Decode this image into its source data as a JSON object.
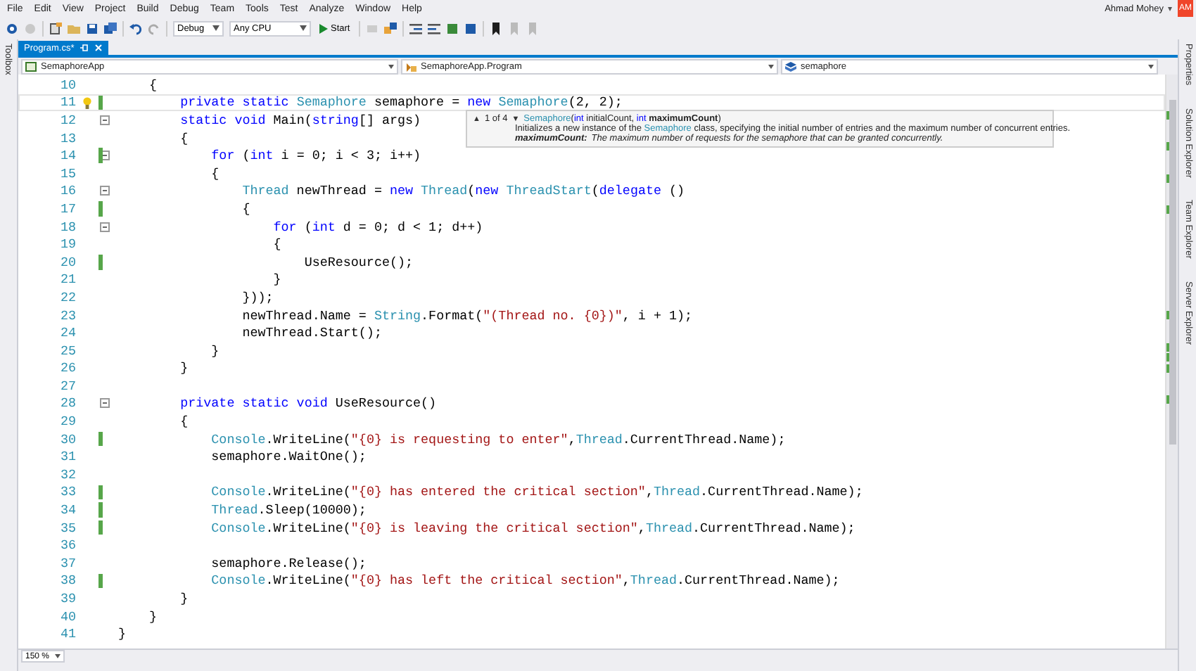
{
  "menu": [
    "File",
    "Edit",
    "View",
    "Project",
    "Build",
    "Debug",
    "Team",
    "Tools",
    "Test",
    "Analyze",
    "Window",
    "Help"
  ],
  "user": {
    "name": "Ahmad Mohey",
    "caret": "▾",
    "initials": "AM"
  },
  "toolbar": {
    "configuration": "Debug",
    "platform": "Any CPU",
    "start": "Start"
  },
  "toolbox": {
    "label": "Toolbox"
  },
  "tabs": [
    {
      "label": "Program.cs*",
      "selected": true
    }
  ],
  "nav": [
    "SemaphoreApp",
    "SemaphoreApp.Program",
    "semaphore"
  ],
  "editor": {
    "lines": [
      {
        "n": "10",
        "changed": false,
        "current": false,
        "tokens": [
          {
            "text": "    {",
            "kind": "plain"
          }
        ]
      },
      {
        "n": "11",
        "changed": true,
        "current": true,
        "lightbulb": true,
        "tokens": [
          {
            "text": "        private static ",
            "kind": "kw"
          },
          {
            "text": "Semaphore",
            "kind": "type"
          },
          {
            "text": " semaphore = ",
            "kind": "plain"
          },
          {
            "text": "new ",
            "kind": "kw"
          },
          {
            "text": "Semaphore",
            "kind": "type"
          },
          {
            "text": "(2, 2);",
            "kind": "plain"
          }
        ]
      },
      {
        "n": "12",
        "changed": false,
        "current": false,
        "expanded": true,
        "tokens": [
          {
            "text": "        static void ",
            "kind": "kw"
          },
          {
            "text": "Main(",
            "kind": "plain"
          },
          {
            "text": "string",
            "kind": "kw"
          },
          {
            "text": "[] args)",
            "kind": "plain"
          }
        ]
      },
      {
        "n": "13",
        "changed": false,
        "current": false,
        "tokens": [
          {
            "text": "        {",
            "kind": "plain"
          }
        ]
      },
      {
        "n": "14",
        "changed": true,
        "current": false,
        "expanded": true,
        "tokens": [
          {
            "text": "            for ",
            "kind": "kw"
          },
          {
            "text": "(",
            "kind": "plain"
          },
          {
            "text": "int",
            "kind": "kw"
          },
          {
            "text": " i = 0; i < 3; i++)",
            "kind": "plain"
          }
        ]
      },
      {
        "n": "15",
        "changed": false,
        "current": false,
        "tokens": [
          {
            "text": "            {",
            "kind": "plain"
          }
        ]
      },
      {
        "n": "16",
        "changed": false,
        "current": false,
        "expanded": true,
        "tokens": [
          {
            "text": "                Thread",
            "kind": "type"
          },
          {
            "text": " newThread = ",
            "kind": "plain"
          },
          {
            "text": "new ",
            "kind": "kw"
          },
          {
            "text": "Thread",
            "kind": "type"
          },
          {
            "text": "(",
            "kind": "plain"
          },
          {
            "text": "new ",
            "kind": "kw"
          },
          {
            "text": "ThreadStart",
            "kind": "type"
          },
          {
            "text": "(",
            "kind": "plain"
          },
          {
            "text": "delegate",
            "kind": "kw"
          },
          {
            "text": " ()",
            "kind": "plain"
          }
        ]
      },
      {
        "n": "17",
        "changed": true,
        "current": false,
        "tokens": [
          {
            "text": "                {",
            "kind": "plain"
          }
        ]
      },
      {
        "n": "18",
        "changed": false,
        "current": false,
        "expanded": true,
        "tokens": [
          {
            "text": "                    for ",
            "kind": "kw"
          },
          {
            "text": "(",
            "kind": "plain"
          },
          {
            "text": "int",
            "kind": "kw"
          },
          {
            "text": " d = 0; d < 1; d++)",
            "kind": "plain"
          }
        ]
      },
      {
        "n": "19",
        "changed": false,
        "current": false,
        "tokens": [
          {
            "text": "                    {",
            "kind": "plain"
          }
        ]
      },
      {
        "n": "20",
        "changed": true,
        "current": false,
        "tokens": [
          {
            "text": "                        UseResource();",
            "kind": "plain"
          }
        ]
      },
      {
        "n": "21",
        "changed": false,
        "current": false,
        "tokens": [
          {
            "text": "                    }",
            "kind": "plain"
          }
        ]
      },
      {
        "n": "22",
        "changed": false,
        "current": false,
        "tokens": [
          {
            "text": "                }));",
            "kind": "plain"
          }
        ]
      },
      {
        "n": "23",
        "changed": false,
        "current": false,
        "tokens": [
          {
            "text": "                newThread.Name = ",
            "kind": "plain"
          },
          {
            "text": "String",
            "kind": "type"
          },
          {
            "text": ".Format(",
            "kind": "plain"
          },
          {
            "text": "\"(Thread no. {0})\"",
            "kind": "str"
          },
          {
            "text": ", i + 1);",
            "kind": "plain"
          }
        ]
      },
      {
        "n": "24",
        "changed": false,
        "current": false,
        "tokens": [
          {
            "text": "                newThread.Start();",
            "kind": "plain"
          }
        ]
      },
      {
        "n": "25",
        "changed": false,
        "current": false,
        "tokens": [
          {
            "text": "            }",
            "kind": "plain"
          }
        ]
      },
      {
        "n": "26",
        "changed": false,
        "current": false,
        "tokens": [
          {
            "text": "        }",
            "kind": "plain"
          }
        ]
      },
      {
        "n": "27",
        "changed": false,
        "current": false
      },
      {
        "n": "28",
        "changed": false,
        "current": false,
        "expanded": true,
        "tokens": [
          {
            "text": "        private static void ",
            "kind": "kw"
          },
          {
            "text": "UseResource()",
            "kind": "plain"
          }
        ]
      },
      {
        "n": "29",
        "changed": false,
        "current": false,
        "tokens": [
          {
            "text": "        {",
            "kind": "plain"
          }
        ]
      },
      {
        "n": "30",
        "changed": true,
        "current": false,
        "tokens": [
          {
            "text": "            Console",
            "kind": "type"
          },
          {
            "text": ".WriteLine(",
            "kind": "plain"
          },
          {
            "text": "\"{0} is requesting to enter\"",
            "kind": "str"
          },
          {
            "text": ",",
            "kind": "plain"
          },
          {
            "text": "Thread",
            "kind": "type"
          },
          {
            "text": ".CurrentThread.Name);",
            "kind": "plain"
          }
        ]
      },
      {
        "n": "31",
        "changed": false,
        "current": false,
        "tokens": [
          {
            "text": "            semaphore.WaitOne();",
            "kind": "plain"
          }
        ]
      },
      {
        "n": "32",
        "changed": false,
        "current": false
      },
      {
        "n": "33",
        "changed": true,
        "current": false,
        "tokens": [
          {
            "text": "            Console",
            "kind": "type"
          },
          {
            "text": ".WriteLine(",
            "kind": "plain"
          },
          {
            "text": "\"{0} has entered the critical section\"",
            "kind": "str"
          },
          {
            "text": ",",
            "kind": "plain"
          },
          {
            "text": "Thread",
            "kind": "type"
          },
          {
            "text": ".CurrentThread.Name);",
            "kind": "plain"
          }
        ]
      },
      {
        "n": "34",
        "changed": true,
        "current": false,
        "tokens": [
          {
            "text": "            Thread",
            "kind": "type"
          },
          {
            "text": ".Sleep(10000);",
            "kind": "plain"
          }
        ]
      },
      {
        "n": "35",
        "changed": true,
        "current": false,
        "tokens": [
          {
            "text": "            Console",
            "kind": "type"
          },
          {
            "text": ".WriteLine(",
            "kind": "plain"
          },
          {
            "text": "\"{0} is leaving the critical section\"",
            "kind": "str"
          },
          {
            "text": ",",
            "kind": "plain"
          },
          {
            "text": "Thread",
            "kind": "type"
          },
          {
            "text": ".CurrentThread.Name);",
            "kind": "plain"
          }
        ]
      },
      {
        "n": "36",
        "changed": false,
        "current": false
      },
      {
        "n": "37",
        "changed": false,
        "current": false,
        "tokens": [
          {
            "text": "            semaphore.Release();",
            "kind": "plain"
          }
        ]
      },
      {
        "n": "38",
        "changed": true,
        "current": false,
        "tokens": [
          {
            "text": "            Console",
            "kind": "type"
          },
          {
            "text": ".WriteLine(",
            "kind": "plain"
          },
          {
            "text": "\"{0} has left the critical section\"",
            "kind": "str"
          },
          {
            "text": ",",
            "kind": "plain"
          },
          {
            "text": "Thread",
            "kind": "type"
          },
          {
            "text": ".CurrentThread.Name);",
            "kind": "plain"
          }
        ]
      },
      {
        "n": "39",
        "changed": false,
        "current": false,
        "tokens": [
          {
            "text": "        }",
            "kind": "plain"
          }
        ]
      },
      {
        "n": "40",
        "changed": false,
        "current": false,
        "tokens": [
          {
            "text": "    }",
            "kind": "plain"
          }
        ]
      },
      {
        "n": "41",
        "changed": false,
        "current": false,
        "tokens": [
          {
            "text": "}",
            "kind": "plain"
          }
        ]
      }
    ]
  },
  "tooltip": {
    "up": "▲",
    "counter": "1 of 4",
    "down": "▼",
    "signature": [
      {
        "text": "Semaphore",
        "kind": "type"
      },
      {
        "text": "(",
        "kind": "plain"
      },
      {
        "text": "int",
        "kind": "kw"
      },
      {
        "text": " initialCount, ",
        "kind": "plain"
      },
      {
        "text": "int",
        "kind": "kw"
      },
      {
        "text": " maximumCount",
        "kind": "bold"
      },
      {
        "text": ")",
        "kind": "plain"
      }
    ],
    "description": [
      {
        "text": "Initializes a new instance of the ",
        "kind": "plain"
      },
      {
        "text": "Semaphore",
        "kind": "type"
      },
      {
        "text": " class, specifying the initial number of entries and the maximum number of concurrent entries.",
        "kind": "plain"
      }
    ],
    "param_name": "maximumCount:",
    "param_description": "The maximum number of requests for the semaphore that can be granted concurrently."
  },
  "side_tabs": [
    "Properties",
    "Solution Explorer",
    "Team Explorer",
    "Server Explorer"
  ],
  "status": {
    "zoom": "150 %"
  }
}
